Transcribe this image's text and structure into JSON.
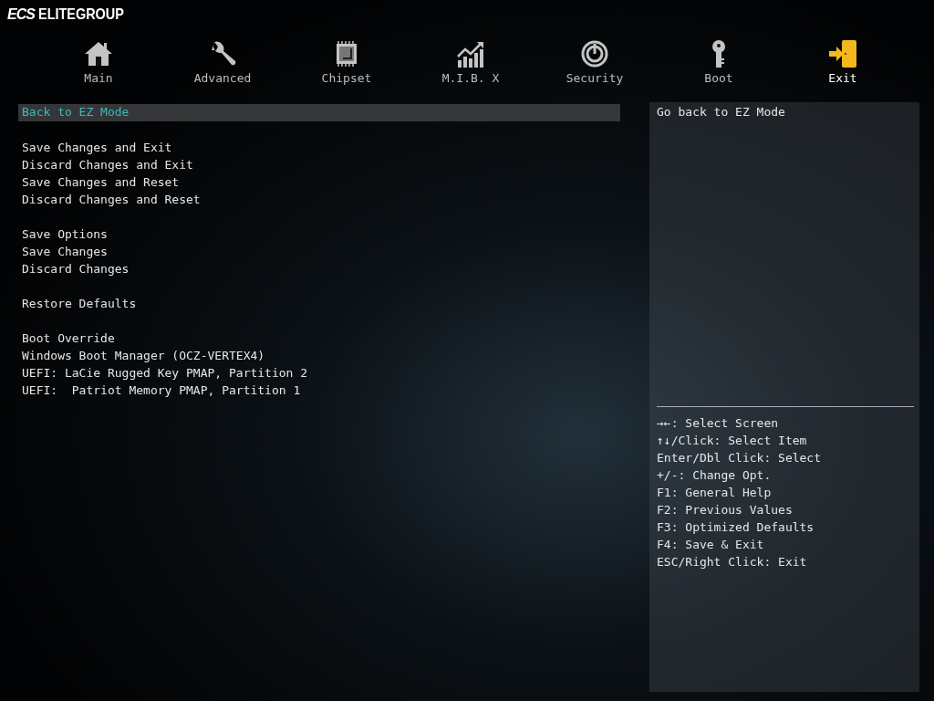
{
  "brand": {
    "mark": "ECS",
    "name": "ELITEGROUP"
  },
  "tabs": [
    {
      "label": "Main",
      "selected": false
    },
    {
      "label": "Advanced",
      "selected": false
    },
    {
      "label": "Chipset",
      "selected": false
    },
    {
      "label": "M.I.B. X",
      "selected": false
    },
    {
      "label": "Security",
      "selected": false
    },
    {
      "label": "Boot",
      "selected": false
    },
    {
      "label": "Exit",
      "selected": true
    }
  ],
  "menu_groups": [
    [
      {
        "label": "Back to EZ Mode",
        "selected": true
      }
    ],
    [
      {
        "label": "Save Changes and Exit",
        "selected": false
      },
      {
        "label": "Discard Changes and Exit",
        "selected": false
      },
      {
        "label": "Save Changes and Reset",
        "selected": false
      },
      {
        "label": "Discard Changes and Reset",
        "selected": false
      }
    ],
    [
      {
        "label": "Save Options",
        "selected": false
      },
      {
        "label": "Save Changes",
        "selected": false
      },
      {
        "label": "Discard Changes",
        "selected": false
      }
    ],
    [
      {
        "label": "Restore Defaults",
        "selected": false
      }
    ],
    [
      {
        "label": "Boot Override",
        "selected": false
      },
      {
        "label": "Windows Boot Manager (OCZ-VERTEX4)",
        "selected": false
      },
      {
        "label": "UEFI: LaCie Rugged Key PMAP, Partition 2",
        "selected": false
      },
      {
        "label": "UEFI:  Patriot Memory PMAP, Partition 1",
        "selected": false
      }
    ]
  ],
  "help": {
    "description": "Go back to EZ Mode",
    "keys": [
      "→←: Select Screen",
      "↑↓/Click: Select Item",
      "Enter/Dbl Click: Select",
      "+/-: Change Opt.",
      "F1: General Help",
      "F2: Previous Values",
      "F3: Optimized Defaults",
      "F4: Save & Exit",
      "ESC/Right Click: Exit"
    ]
  }
}
